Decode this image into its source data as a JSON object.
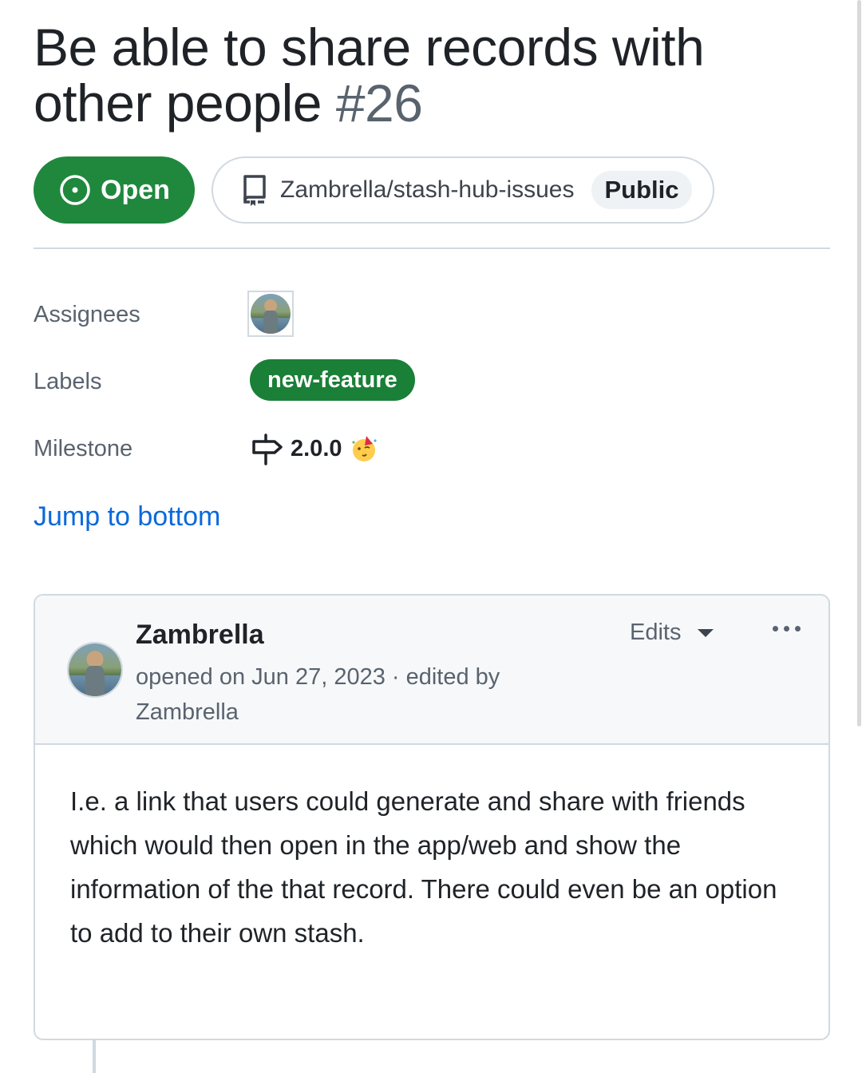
{
  "issue": {
    "title": "Be able to share records with other people",
    "number": "#26",
    "state": "Open",
    "repository": "Zambrella/stash-hub-issues",
    "visibility": "Public"
  },
  "sidebar": {
    "assignees_label": "Assignees",
    "labels_label": "Labels",
    "label_name": "new-feature",
    "milestone_label": "Milestone",
    "milestone_name": "2.0.0"
  },
  "jump_link": "Jump to bottom",
  "comment": {
    "author": "Zambrella",
    "meta": "opened on Jun 27, 2023 · edited by Zambrella",
    "edits_label": "Edits",
    "body": "I.e. a link that users could generate and share with friends which would then open in the app/web and show the information of the that record. There could even be an option to add to their own stash."
  },
  "colors": {
    "open_green": "#1f883d",
    "label_green": "#1a7f37",
    "link_blue": "#0969da",
    "muted_text": "#59636e",
    "border": "#d1d9e0"
  },
  "icons": [
    "issue-opened-icon",
    "repo-icon",
    "avatar",
    "milestone-icon",
    "party-face-emoji",
    "triangle-down-icon",
    "kebab-horizontal-icon"
  ]
}
